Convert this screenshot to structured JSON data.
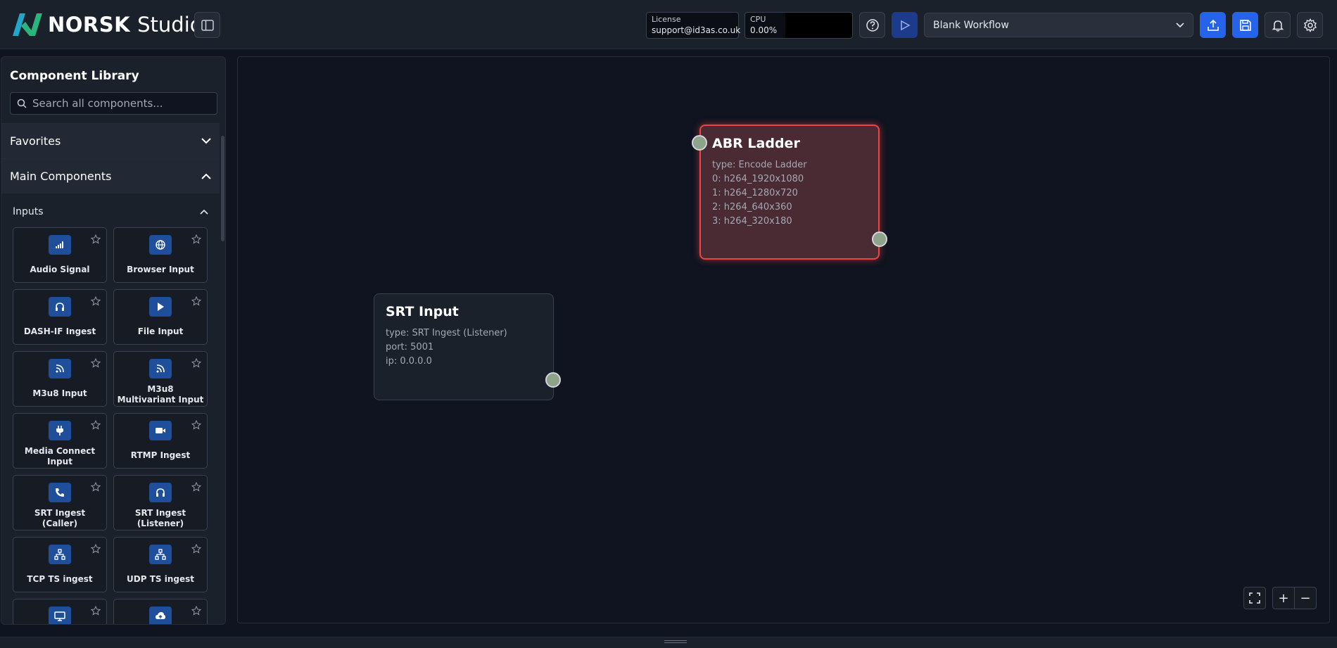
{
  "app": {
    "brand": "NORSK",
    "product": "Studio"
  },
  "header": {
    "license_label": "License",
    "license_value": "support@id3as.co.uk",
    "cpu_label": "CPU",
    "cpu_value": "0.00%",
    "workflow_selected": "Blank Workflow"
  },
  "library": {
    "title": "Component Library",
    "search_placeholder": "Search all components...",
    "favorites_label": "Favorites",
    "main_label": "Main Components",
    "inputs_label": "Inputs",
    "components": [
      {
        "label": "Audio Signal",
        "icon": "signal-icon"
      },
      {
        "label": "Browser Input",
        "icon": "globe-icon"
      },
      {
        "label": "DASH-IF Ingest",
        "icon": "headphones-icon"
      },
      {
        "label": "File Input",
        "icon": "play-icon"
      },
      {
        "label": "M3u8 Input",
        "icon": "rss-icon"
      },
      {
        "label": "M3u8 Multivariant Input",
        "icon": "rss-icon"
      },
      {
        "label": "Media Connect Input",
        "icon": "plug-icon"
      },
      {
        "label": "RTMP Ingest",
        "icon": "video-icon"
      },
      {
        "label": "SRT Ingest (Caller)",
        "icon": "phone-icon"
      },
      {
        "label": "SRT Ingest (Listener)",
        "icon": "headphones-icon"
      },
      {
        "label": "TCP TS ingest",
        "icon": "network-icon"
      },
      {
        "label": "UDP TS ingest",
        "icon": "network-icon"
      },
      {
        "label": "",
        "icon": "monitor-icon"
      },
      {
        "label": "",
        "icon": "cloud-upload-icon"
      }
    ]
  },
  "canvas": {
    "nodes": {
      "srt": {
        "title": "SRT Input",
        "lines": [
          "type: SRT Ingest (Listener)",
          "port: 5001",
          "ip: 0.0.0.0"
        ]
      },
      "abr": {
        "title": "ABR Ladder",
        "lines": [
          "type: Encode Ladder",
          "0: h264_1920x1080",
          "1: h264_1280x720",
          "2: h264_640x360",
          "3: h264_320x180"
        ]
      }
    },
    "zoom_in": "+",
    "zoom_out": "−"
  },
  "colors": {
    "accent": "#2563eb",
    "node_selected_border": "#ef4444",
    "port": "#8da38a",
    "icon_bg": "#1f4f9a"
  }
}
